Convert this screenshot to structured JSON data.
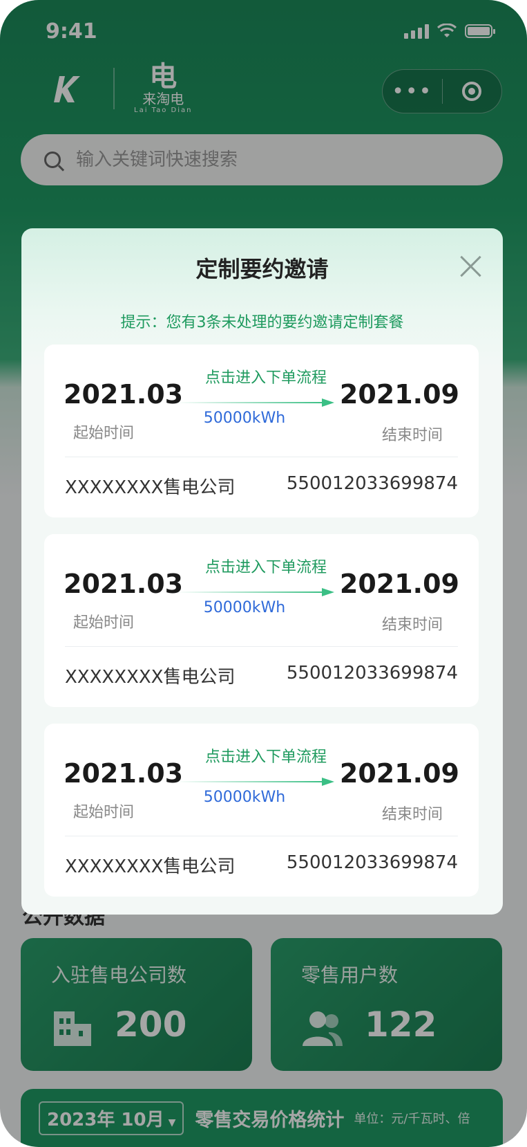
{
  "status_bar": {
    "time": "9:41"
  },
  "brand": {
    "logo_mark": "电",
    "name_cn": "来淘电",
    "name_en": "Lai Tao Dian"
  },
  "capsule": {
    "more_label": "•••"
  },
  "search": {
    "placeholder": "输入关键词快速搜索"
  },
  "modal": {
    "title": "定制要约邀请",
    "tip": "提示：您有3条未处理的要约邀请定制套餐",
    "cards": [
      {
        "start_date": "2021.03",
        "start_label": "起始时间",
        "action": "点击进入下单流程",
        "energy": "50000kWh",
        "end_date": "2021.09",
        "end_label": "结束时间",
        "company": "XXXXXXXX售电公司",
        "number": "550012033699874"
      },
      {
        "start_date": "2021.03",
        "start_label": "起始时间",
        "action": "点击进入下单流程",
        "energy": "50000kWh",
        "end_date": "2021.09",
        "end_label": "结束时间",
        "company": "XXXXXXXX售电公司",
        "number": "550012033699874"
      },
      {
        "start_date": "2021.03",
        "start_label": "起始时间",
        "action": "点击进入下单流程",
        "energy": "50000kWh",
        "end_date": "2021.09",
        "end_label": "结束时间",
        "company": "XXXXXXXX售电公司",
        "number": "550012033699874"
      }
    ]
  },
  "background": {
    "section_title": "公开数据",
    "stats": [
      {
        "label": "入驻售电公司数",
        "value": "200",
        "icon": "building-icon"
      },
      {
        "label": "零售用户数",
        "value": "122",
        "icon": "users-icon"
      }
    ],
    "price_bar": {
      "period": "2023年 10月",
      "title": "零售交易价格统计",
      "unit": "单位：元/千瓦时、倍"
    }
  },
  "colors": {
    "primary_green": "#1f9a64",
    "tip_green": "#1e9a5e",
    "energy_blue": "#2f6ad9"
  }
}
